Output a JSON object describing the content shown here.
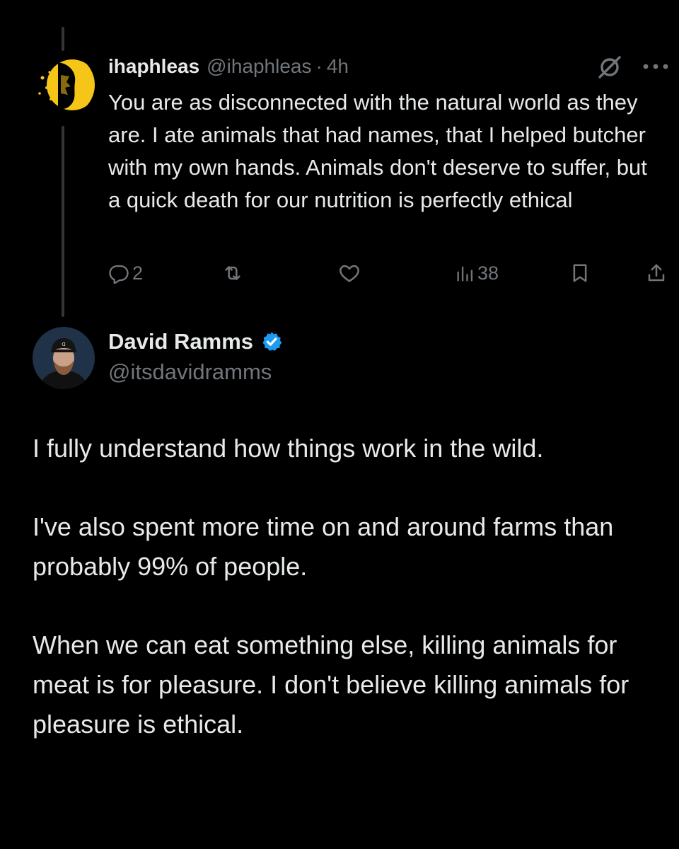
{
  "reply_tweet": {
    "author_name": "ihaphleas",
    "handle": "@ihaphleas",
    "separator": "·",
    "time": "4h",
    "avatar_icon": "yellow-portrait-avatar",
    "text": "You are as disconnected with the natural world as they are. I ate animals that had names, that I helped butcher with my own hands. Animals don't deserve to suffer, but a quick death for our nutrition is perfectly ethical",
    "stats": {
      "replies": "2",
      "reposts": "",
      "likes": "",
      "views": "38"
    },
    "icons": [
      "grok-icon",
      "more-icon",
      "reply-icon",
      "repost-icon",
      "like-icon",
      "views-icon",
      "bookmark-icon",
      "share-icon"
    ]
  },
  "main_tweet": {
    "author_name": "David Ramms",
    "handle": "@itsdavidramms",
    "verified": true,
    "avatar_icon": "bearded-man-cap-avatar",
    "paragraphs": [
      "I fully understand how things work in the wild.",
      "I've also spent more time on and around farms than probably 99% of people.",
      "When we can eat something else, killing animals for meat is for pleasure. I don't believe killing animals for pleasure is ethical."
    ]
  },
  "colors": {
    "background": "#000000",
    "text_primary": "#e7e9ea",
    "text_secondary": "#71767b",
    "thread_line": "#333639",
    "verified_blue": "#1d9bf0",
    "avatar_yellow": "#f5c518"
  }
}
